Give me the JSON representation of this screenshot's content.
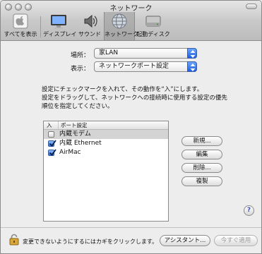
{
  "window": {
    "title": "ネットワーク"
  },
  "toolbar": {
    "items": [
      {
        "label": "すべてを表示",
        "icon": "apple-grid-icon"
      },
      {
        "label": "ディスプレイ",
        "icon": "display-icon"
      },
      {
        "label": "サウンド",
        "icon": "speaker-icon"
      },
      {
        "label": "ネットワーク",
        "icon": "network-globe-icon",
        "selected": true
      },
      {
        "label": "起動ディスク",
        "icon": "disk-icon"
      }
    ]
  },
  "location": {
    "label": "場所：",
    "value": "家LAN"
  },
  "show": {
    "label": "表示：",
    "value": "ネットワークポート設定"
  },
  "description": {
    "line1": "設定にチェックマークを入れて、その動作を“入”にします。",
    "line2": "設定をドラッグして、ネットワークへの接続時に使用する設定の優先",
    "line3": "順位を指定してください。"
  },
  "port_list": {
    "header_on": "入",
    "header_name": "ポート設定",
    "rows": [
      {
        "name": "内蔵モデム",
        "checked": false,
        "selected": true
      },
      {
        "name": "内蔵 Ethernet",
        "checked": true,
        "selected": false
      },
      {
        "name": "AirMac",
        "checked": true,
        "selected": false
      }
    ]
  },
  "buttons": {
    "new": "新規...",
    "edit": "編集",
    "delete": "削除...",
    "duplicate": "複製"
  },
  "help": {
    "label": "?"
  },
  "footer": {
    "lock_text": "変更できないようにするにはカギをクリックします。",
    "assistant": "アシスタント...",
    "apply": "今すぐ適用"
  },
  "colors": {
    "accent": "#2f6fe0",
    "lock": "#c99a2e"
  }
}
